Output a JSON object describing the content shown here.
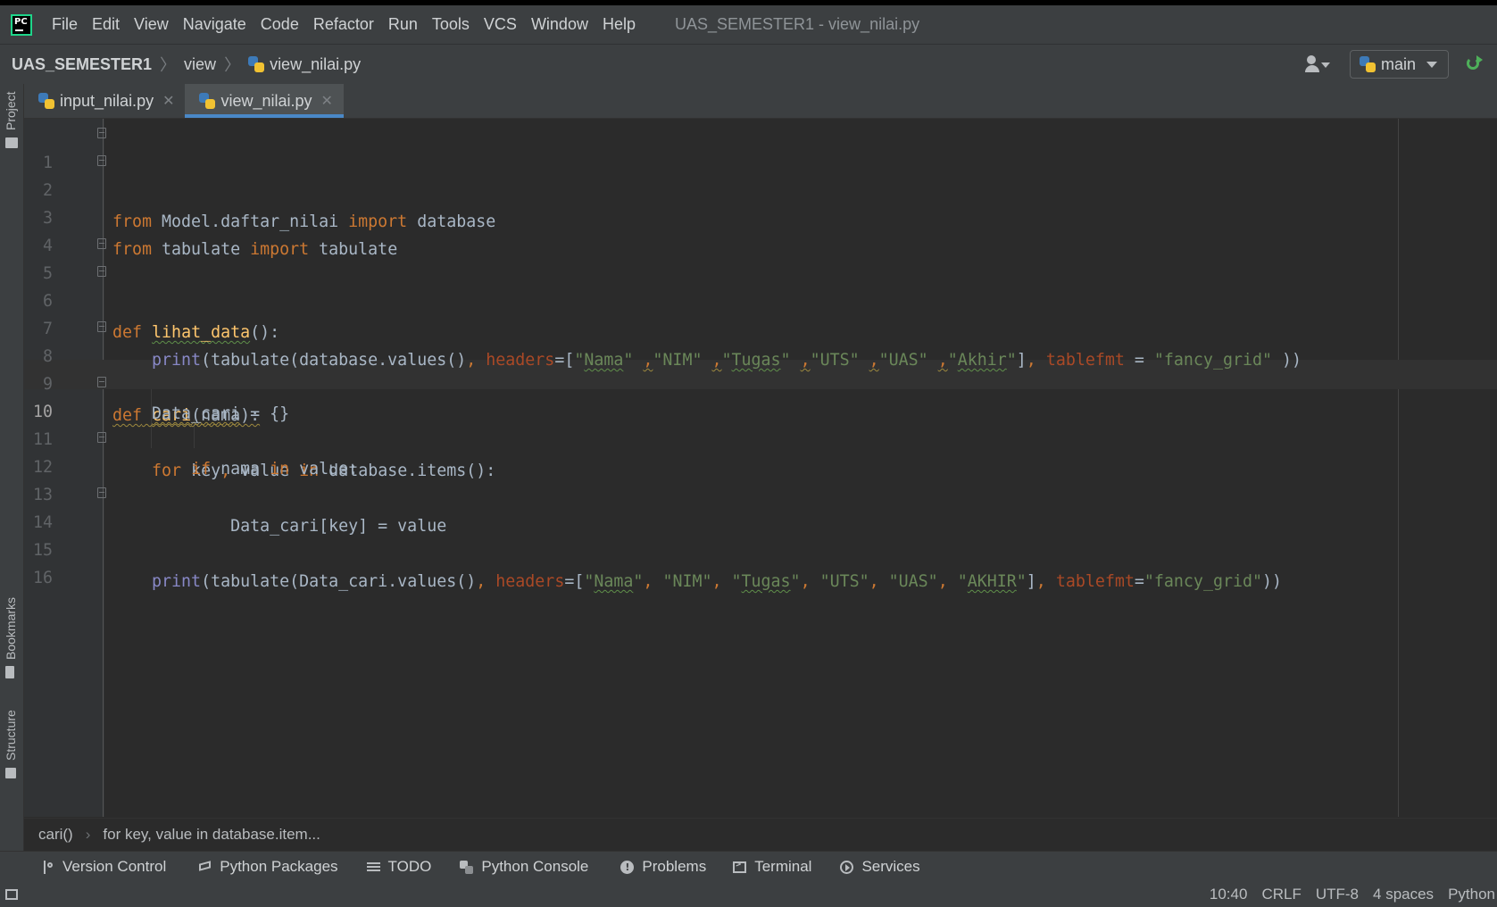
{
  "menu": {
    "items": [
      "File",
      "Edit",
      "View",
      "Navigate",
      "Code",
      "Refactor",
      "Run",
      "Tools",
      "VCS",
      "Window",
      "Help"
    ],
    "window_title": "UAS_SEMESTER1 - view_nilai.py"
  },
  "navbar": {
    "project": "UAS_SEMESTER1",
    "folder": "view",
    "file": "view_nilai.py",
    "run_config": "main"
  },
  "side_labels": {
    "project": "Project",
    "bookmarks": "Bookmarks",
    "structure": "Structure"
  },
  "tabs": [
    {
      "label": "input_nilai.py",
      "active": false
    },
    {
      "label": "view_nilai.py",
      "active": true
    }
  ],
  "editor": {
    "current_line": 10,
    "line_numbers": [
      "1",
      "2",
      "3",
      "4",
      "5",
      "6",
      "7",
      "8",
      "9",
      "10",
      "11",
      "12",
      "13",
      "14",
      "15",
      "16"
    ],
    "lines": [
      "from Model.daftar_nilai import database",
      "from tabulate import tabulate",
      "",
      "",
      "def lihat_data():",
      "    print(tabulate(database.values(), headers=[\"Nama\" ,\"NIM\" ,\"Tugas\" ,\"UTS\" ,\"UAS\" ,\"Akhir\"], tablefmt = \"fancy_grid\" ))",
      "",
      "def cari(nama):",
      "    Data_cari = {}",
      "    for key, value in database.items():",
      "        if nama in value:",
      "            Data_cari[key] = value",
      "",
      "    print(tabulate(Data_cari.values(), headers=[\"Nama\", \"NIM\", \"Tugas\", \"UTS\", \"UAS\", \"AKHIR\"], tablefmt=\"fancy_grid\"))",
      "",
      ""
    ]
  },
  "code_breadcrumb": {
    "function": "cari()",
    "statement": "for key, value in database.item..."
  },
  "tool_windows": [
    "Version Control",
    "Python Packages",
    "TODO",
    "Python Console",
    "Problems",
    "Terminal",
    "Services"
  ],
  "status": {
    "position": "10:40",
    "line_sep": "CRLF",
    "encoding": "UTF-8",
    "indent": "4 spaces",
    "interpreter": "Python"
  },
  "colors": {
    "keyword": "#cc7832",
    "function": "#ffc66d",
    "string": "#6a8759",
    "param": "#aa4926",
    "builtin": "#8888c6",
    "accent": "#4a88c7"
  }
}
